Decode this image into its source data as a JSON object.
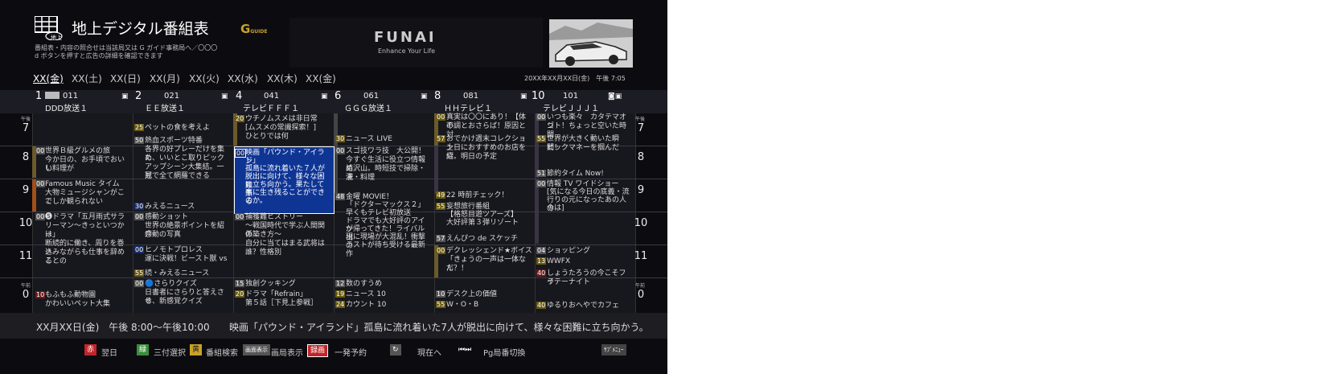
{
  "header": {
    "title": "地上デジタル番組表",
    "icon_label": "地上",
    "subtitle_1": "番組表・内容の照合せは当該局又は G ガイド事務局へ／〇〇〇",
    "subtitle_2": "d ボタンを押すと広告の詳細を確認できます",
    "gguide_logo": "GUIDE",
    "ad_brand": "FUNAI",
    "ad_tagline": "Enhance Your Life"
  },
  "days": [
    "XX(金)",
    "XX(土)",
    "XX(日)",
    "XX(月)",
    "XX(火)",
    "XX(水)",
    "XX(木)",
    "XX(金)"
  ],
  "datetime": "20XX年XX月XX日(金)　午後 7:05",
  "channels": [
    {
      "num": "1",
      "code": "011",
      "name": "DDD放送１"
    },
    {
      "num": "2",
      "code": "021",
      "name": "ＥＥ放送１"
    },
    {
      "num": "4",
      "code": "041",
      "name": "テレビＦＦＦ１"
    },
    {
      "num": "6",
      "code": "061",
      "name": "ＧＧＧ放送１"
    },
    {
      "num": "8",
      "code": "081",
      "name": "ＨＨテレビ１"
    },
    {
      "num": "10",
      "code": "101",
      "name": "テレビＪＪＪ１"
    }
  ],
  "hours": [
    "7",
    "8",
    "9",
    "10",
    "11",
    "0"
  ],
  "ampm": {
    "pm": "午後",
    "am": "午前"
  },
  "programs": {
    "c1": [
      {
        "min": "00",
        "text": [
          "世界Ｂ級グルメの旅",
          "今か日の、お手頃でおいし",
          "い料理が"
        ]
      },
      {
        "min": "00",
        "text": [
          "Famous Music タイム",
          "大物ミュージシャンがここ",
          "でしか観られない"
        ]
      },
      {
        "min": "00",
        "text": [
          "🅢ドラマ「五月雨式サラ",
          "リーマン〜きっといつかは",
          "ー」",
          "断続的に働き、周りを巻き",
          "込みながらも仕事を辞める",
          "ことの"
        ]
      },
      {
        "min": "10",
        "text": [
          "もふもふ動物園",
          "かわいいペット大集"
        ]
      }
    ],
    "c2": [
      {
        "min": "25",
        "text": [
          "ペットの食を考えよ"
        ]
      },
      {
        "min": "50",
        "text": [
          "熱血スポーツ特番",
          "各界の好プレーだけを集め",
          "た、いいとこ取りピック",
          "アップシーン大集結。一冠",
          "見で全て網羅できる"
        ]
      },
      {
        "min": "30",
        "text": [
          "みえるニュース"
        ]
      },
      {
        "min": "00",
        "text": [
          "感動ショット",
          "世界の絶景ポイントを紹介",
          "感動の写真"
        ]
      },
      {
        "min": "00",
        "text": [
          "ヒノモトプロレス",
          "運に決戦！ビースト獣 vs"
        ]
      },
      {
        "min": "55",
        "text": [
          "続・みえるニュース"
        ]
      },
      {
        "min": "00",
        "text": [
          "🔵さらりクイズ",
          "日書者にさらりと答えさせ",
          "る、新感覚クイズ"
        ]
      }
    ],
    "c3": [
      {
        "min": "20",
        "text": [
          "ウチノムスメは非日常",
          "[ムスメの常識探索！]",
          "ひとりでは何"
        ]
      },
      {
        "min": "00",
        "text": [
          "映画「パウンド・アイラン",
          "ド」",
          "孤島に流れ着いた７人が",
          "脱出に向けて、様々な困難",
          "に立ち向かう。果たして無",
          "事に生き残ることができる",
          "のか。"
        ]
      },
      {
        "min": "00",
        "text": [
          "捕獲難ヒストリー",
          "〜戦国時代で学ぶ人間関係",
          "の築き方〜",
          "自分に当てはまる武将は",
          "誰？性格別"
        ]
      },
      {
        "min": "15",
        "text": [
          "独創クッキング"
        ]
      },
      {
        "min": "20",
        "text": [
          "ドラマ「Refrain」",
          "第５話［下見上参戦］"
        ]
      }
    ],
    "c4": [
      {
        "min": "30",
        "text": [
          "ニュース LIVE"
        ]
      },
      {
        "min": "00",
        "text": [
          "スゴ技ワラ技　大公開！",
          "今すぐ生活に役立つ情報詰",
          "め沢山。時短技で掃除・洗",
          "濯・料理"
        ]
      },
      {
        "min": "48",
        "text": [
          "金曜 MOVIE！",
          "「ドクターマックス２」",
          "早くもテレビ初放送",
          "ドラマでも大好評のアイツ",
          "が帰ってきた！ライバル出",
          "現に現場が大混乱！衝撃の",
          "ラストが待ち受ける最新作"
        ]
      },
      {
        "min": "12",
        "text": [
          "数のすうめ"
        ]
      },
      {
        "min": "19",
        "text": [
          "ニュース 10"
        ]
      },
      {
        "min": "24",
        "text": [
          "カウント 10"
        ]
      }
    ],
    "c5": [
      {
        "min": "00",
        "text": [
          "真実は〇〇にあり！【体の",
          "不調とおさらば！原因と対"
        ]
      },
      {
        "min": "57",
        "text": [
          "おでかけ週末コレクション",
          "土日におすすめのお店を紹",
          "介。明日の予定"
        ]
      },
      {
        "min": "49",
        "text": [
          "22 時前チェック！"
        ]
      },
      {
        "min": "55",
        "text": [
          "妄想旅行番組",
          "【格怒目遊ツアーズ】",
          "大好評第３弾リゾート"
        ]
      },
      {
        "min": "57",
        "text": [
          "えんぴつ de スケッチ"
        ]
      },
      {
        "min": "00",
        "text": [
          "デクレッシェンド★ボイス",
          "「きょうの一声は一体なん",
          "だ？！"
        ]
      },
      {
        "min": "10",
        "text": [
          "デスク上の価値"
        ]
      },
      {
        "min": "55",
        "text": [
          "W・O・B"
        ]
      }
    ],
    "c6": [
      {
        "min": "00",
        "text": [
          "いつも楽々　カタテマオシ",
          "ゴト！ちょっと空いた時間"
        ]
      },
      {
        "min": "55",
        "text": [
          "世界が大きく動いた瞬間！",
          "ビックマネーを掴んだ"
        ]
      },
      {
        "min": "51",
        "text": [
          "節約タイム Now!"
        ]
      },
      {
        "min": "00",
        "text": [
          "情報 TV ワイドショー",
          "[気になる今日の底義・流",
          "行りの元になったあの人の",
          "今は]"
        ]
      },
      {
        "min": "04",
        "text": [
          "ショッピング"
        ]
      },
      {
        "min": "13",
        "text": [
          "WWFX"
        ]
      },
      {
        "min": "40",
        "text": [
          "しょうたろうの今こそフラ",
          "イテーナイト"
        ]
      },
      {
        "min": "40",
        "text": [
          "ゆるりおへやでカフェ"
        ]
      }
    ]
  },
  "detail_bar": {
    "time": "XX月XX日(金)　午後 8:00〜午後10:00",
    "desc": "映画「パウンド・アイランド」孤島に流れ着いた7人が脱出に向けて、様々な困難に立ち向かう。"
  },
  "footer": {
    "red_btn": "赤",
    "red_label": "翌日",
    "green_btn": "緑",
    "green_label": "三付選択",
    "yellow_btn": "黄",
    "yellow_label": "番組検索",
    "view_btn": "画面表示",
    "view_label": "画局表示",
    "rec_btn": "録画",
    "rec_label": "一発予約",
    "back_label": "現在へ",
    "skip_label": "Pg局番切換",
    "submenu_btn": "ｻﾌﾞﾒﾆｭｰ"
  },
  "colors": {
    "selected": "#0f3594",
    "red": "#c0252b",
    "green": "#3d8c3d",
    "yellow": "#c9a227"
  }
}
